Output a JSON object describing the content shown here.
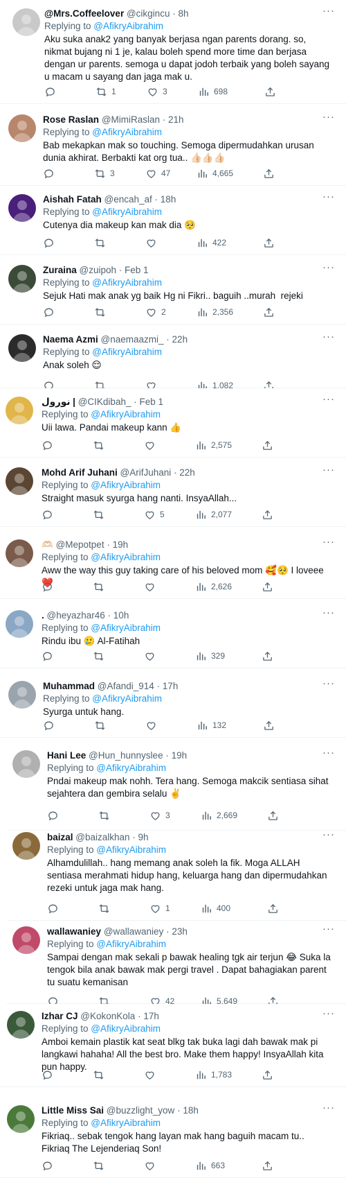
{
  "replying_prefix": "Replying to ",
  "tweets": [
    {
      "name": "@Mrs.Coffeelover",
      "handle": "@cikgincu",
      "time": "8h",
      "replying_to": "@AfikryAibrahim",
      "text": "Aku suka anak2 yang banyak berjasa ngan parents dorang. so, nikmat bujang ni 1 je, kalau boleh spend more time dan berjasa dengan ur parents. semoga u dapat jodoh terbaik yang boleh sayang u macam u sayang dan jaga mak u.",
      "replies": "",
      "retweets": "1",
      "likes": "3",
      "views": "698",
      "avatar_color": "#c9c9c9"
    },
    {
      "name": "Rose Raslan",
      "handle": "@MimiRaslan",
      "time": "21h",
      "replying_to": "@AfikryAibrahim",
      "text": "Bab mekapkan mak so touching. Semoga dipermudahkan urusan dunia akhirat. Berbakti kat org tua.. 👍🏻👍🏻👍🏻",
      "replies": "",
      "retweets": "3",
      "likes": "47",
      "views": "4,665",
      "avatar_color": "#b8866b"
    },
    {
      "name": "Aishah Fatah",
      "handle": "@encah_af",
      "time": "18h",
      "replying_to": "@AfikryAibrahim",
      "text": "Cutenya dia makeup kan mak dia 🥺",
      "replies": "",
      "retweets": "",
      "likes": "",
      "views": "422",
      "avatar_color": "#4a1f7a"
    },
    {
      "name": "Zuraina",
      "handle": "@zuipoh",
      "time": "Feb 1",
      "replying_to": "@AfikryAibrahim",
      "text": "Sejuk Hati mak anak yg baik Hg ni Fikri.. baguih ..murah  rejeki",
      "replies": "",
      "retweets": "",
      "likes": "2",
      "views": "2,356",
      "avatar_color": "#3c4a38"
    },
    {
      "name": "Naema Azmi",
      "handle": "@naemaazmi_",
      "time": "22h",
      "replying_to": "@AfikryAibrahim",
      "text": "Anak soleh 😌",
      "replies": "",
      "retweets": "",
      "likes": "",
      "views": "1,082",
      "avatar_color": "#2b2b2b"
    },
    {
      "name": "نورول |",
      "handle": "@CIKdibah_",
      "time": "Feb 1",
      "replying_to": "@AfikryAibrahim",
      "text": "Uii lawa. Pandai makeup kann 👍",
      "replies": "",
      "retweets": "",
      "likes": "",
      "views": "2,575",
      "avatar_color": "#e0b54a"
    },
    {
      "name": "Mohd Arif Juhani",
      "handle": "@ArifJuhani",
      "time": "22h",
      "replying_to": "@AfikryAibrahim",
      "text": "Straight masuk syurga hang nanti. InsyaAllah...",
      "replies": "",
      "retweets": "",
      "likes": "5",
      "views": "2,077",
      "avatar_color": "#5a4632"
    },
    {
      "name": "🫶🏻",
      "handle": "@Mepotpet",
      "time": "19h",
      "replying_to": "@AfikryAibrahim",
      "text": "Aww the way this guy taking care of his beloved mom 🥰🥺 I loveee ❤️",
      "replies": "",
      "retweets": "",
      "likes": "",
      "views": "2,626",
      "avatar_color": "#7a5a4a"
    },
    {
      "name": ".",
      "handle": "@heyazhar46",
      "time": "10h",
      "replying_to": "@AfikryAibrahim",
      "text": "Rindu ibu 🥲 Al-Fatihah",
      "replies": "",
      "retweets": "",
      "likes": "",
      "views": "329",
      "avatar_color": "#8aa7c4"
    },
    {
      "name": "Muhammad",
      "handle": "@Afandi_914",
      "time": "17h",
      "replying_to": "@AfikryAibrahim",
      "text": "Syurga untuk hang.",
      "replies": "",
      "retweets": "",
      "likes": "",
      "views": "132",
      "avatar_color": "#9aa4ad"
    },
    {
      "name": "Hani Lee",
      "handle": "@Hun_hunnyslee",
      "time": "19h",
      "replying_to": "@AfikryAibrahim",
      "text": "Pndai makeup mak nohh. Tera hang. Semoga makcik sentiasa sihat sejahtera dan gembira selalu ✌️",
      "replies": "",
      "retweets": "",
      "likes": "3",
      "views": "2,669",
      "avatar_color": "#b0b0b0"
    },
    {
      "name": "baizal",
      "handle": "@baizalkhan",
      "time": "9h",
      "replying_to": "@AfikryAibrahim",
      "text": "Alhamdulillah.. hang memang anak soleh la fik. Moga ALLAH sentiasa merahmati hidup hang, keluarga hang dan dipermudahkan rezeki untuk jaga mak hang.",
      "replies": "",
      "retweets": "",
      "likes": "1",
      "views": "400",
      "avatar_color": "#8a6a3a"
    },
    {
      "name": "wallawaniey",
      "handle": "@wallawaniey",
      "time": "23h",
      "replying_to": "@AfikryAibrahim",
      "text": "Sampai dengan mak sekali p bawak healing tgk air terjun 😂 Suka la tengok bila anak bawak mak pergi travel . Dapat bahagiakan parent tu suatu kemanisan",
      "replies": "",
      "retweets": "",
      "likes": "42",
      "views": "5,649",
      "avatar_color": "#c04a6a"
    },
    {
      "name": "Izhar CJ",
      "handle": "@KokonKola",
      "time": "17h",
      "replying_to": "@AfikryAibrahim",
      "text": "Amboi kemain plastik kat seat blkg tak buka lagi dah bawak mak pi langkawi hahaha! All the best bro. Make them happy! InsyaAllah kita pun happy.",
      "replies": "",
      "retweets": "",
      "likes": "",
      "views": "1,783",
      "avatar_color": "#3a5a3a"
    },
    {
      "name": "Little Miss Sai",
      "handle": "@buzzlight_yow",
      "time": "18h",
      "replying_to": "@AfikryAibrahim",
      "text": "Fikriaq.. sebak tengok hang layan mak hang baguih macam tu.. Fikriaq The Lejenderiaq Son!",
      "replies": "",
      "retweets": "",
      "likes": "",
      "views": "663",
      "avatar_color": "#4a7a3a"
    }
  ]
}
